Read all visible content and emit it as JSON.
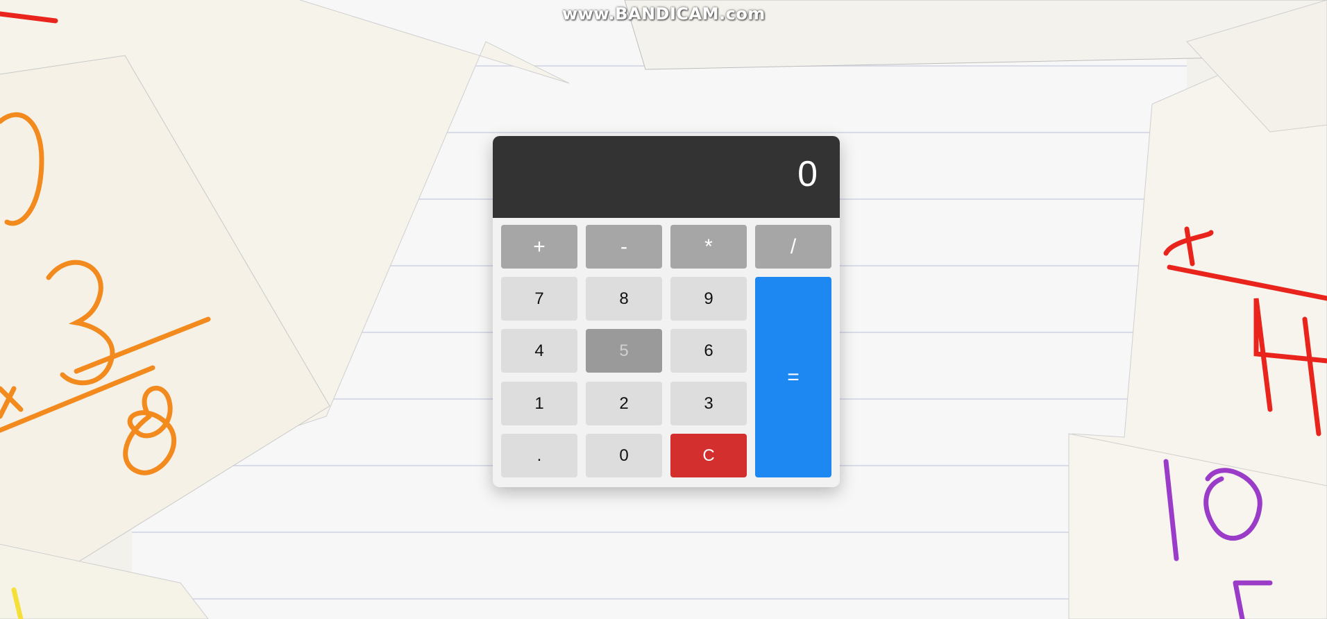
{
  "watermark": "www.BANDICAM.com",
  "calculator": {
    "display_value": "0",
    "operators": [
      "+",
      "-",
      "*",
      "/"
    ],
    "digits": {
      "seven": "7",
      "eight": "8",
      "nine": "9",
      "four": "4",
      "five": "5",
      "six": "6",
      "one": "1",
      "two": "2",
      "three": "3",
      "dot": ".",
      "zero": "0"
    },
    "clear_label": "C",
    "equals_label": "=",
    "colors": {
      "display_bg": "#333333",
      "operator_bg": "#a6a6a6",
      "digit_bg": "#dddddd",
      "clear_bg": "#d32f2f",
      "equals_bg": "#1e88f2"
    }
  }
}
